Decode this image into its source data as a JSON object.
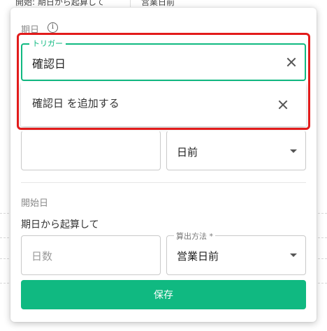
{
  "background": {
    "top_left_text": "開始: 期日から起算して",
    "top_right_text": "営業日前"
  },
  "popover": {
    "due_date_label": "期日",
    "trigger": {
      "legend": "トリガー",
      "value": "確認日",
      "dropdown_option": "確認日 を追加する"
    },
    "offset_row": {
      "days_value": "",
      "unit_value": "日前"
    },
    "start_date": {
      "section_label": "開始日",
      "basis_text": "期日から起算して",
      "days_placeholder": "日数",
      "method_label": "算出方法 *",
      "method_value": "営業日前"
    },
    "save_label": "保存"
  },
  "colors": {
    "accent": "#10b981",
    "highlight": "#e21b1b"
  }
}
